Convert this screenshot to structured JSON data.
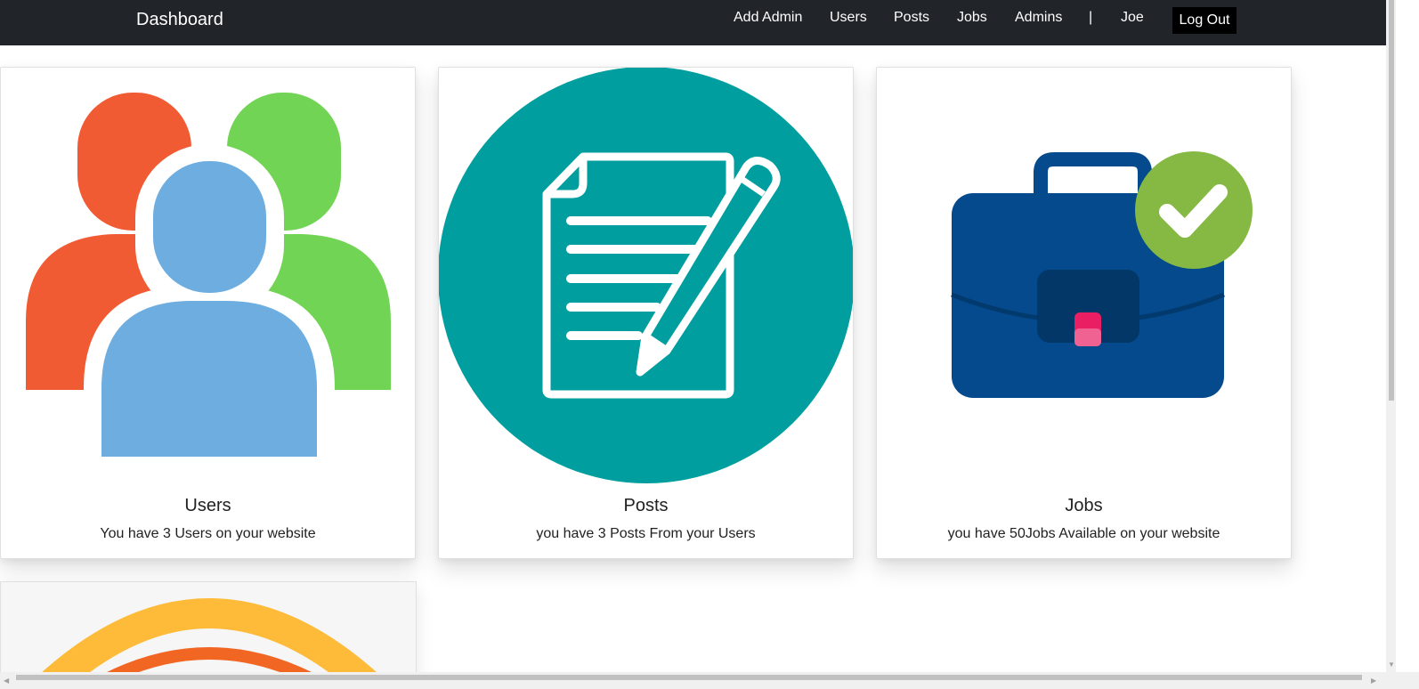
{
  "navbar": {
    "brand": "Dashboard",
    "links": [
      "Add Admin",
      "Users",
      "Posts",
      "Jobs",
      "Admins"
    ],
    "separator": "|",
    "user": "Joe",
    "logout_label": "Log Out"
  },
  "cards": [
    {
      "icon": "users-group-icon",
      "title": "Users",
      "text": "You have 3 Users on your website"
    },
    {
      "icon": "document-pen-icon",
      "title": "Posts",
      "text": "you have 3 Posts From your Users"
    },
    {
      "icon": "briefcase-check-icon",
      "title": "Jobs",
      "text": "you have 50Jobs Available on your website"
    },
    {
      "icon": "orange-arcs-icon"
    }
  ],
  "colors": {
    "navbar_bg": "#212529",
    "users_red": "#f15b33",
    "users_green": "#72d455",
    "users_blue": "#6eade0",
    "posts_teal": "#009e9e",
    "jobs_blue": "#044a8c",
    "jobs_check_green": "#86b943",
    "jobs_clasp_pink": "#e91e63",
    "arc_yellow": "#fdbb39",
    "arc_orange": "#f26624"
  }
}
